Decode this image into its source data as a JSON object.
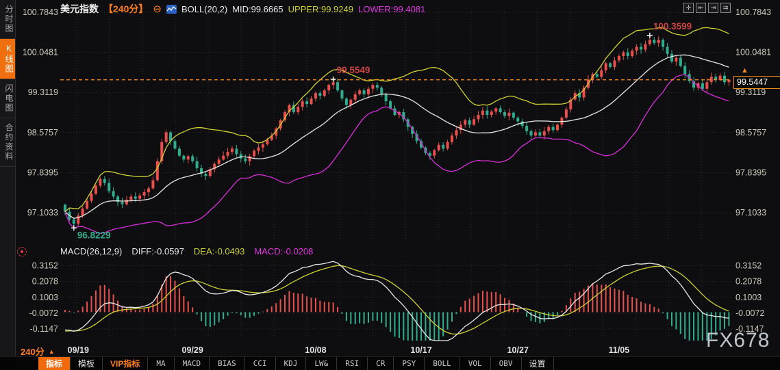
{
  "sidebar": {
    "items": [
      {
        "label": "分时图",
        "active": false
      },
      {
        "label": "K线图",
        "active": true
      },
      {
        "label": "闪电图",
        "active": false
      },
      {
        "label": "合约资料",
        "active": false
      }
    ]
  },
  "header": {
    "title": "美元指数",
    "period": "【240分】",
    "minus_glyph": "⊖",
    "indicator": "BOLL(20,2)",
    "mid": "MID:99.6665",
    "upper": "UPPER:99.9249",
    "lower": "LOWER:99.4081"
  },
  "window_controls": [
    {
      "name": "crosshair-icon",
      "glyph": "✛"
    },
    {
      "name": "scale-left-icon",
      "glyph": "⇤"
    },
    {
      "name": "scale-right-icon",
      "glyph": "⇥"
    },
    {
      "name": "pan-right-icon",
      "glyph": "⇉"
    }
  ],
  "macd_header": {
    "name": "MACD(26,12,9)",
    "diff": "DIFF:-0.0597",
    "dea": "DEA:-0.0493",
    "macd": "MACD:-0.0208"
  },
  "price_box": {
    "value": "99.5447"
  },
  "bottom_left": {
    "period": "240分",
    "arrow": "▲"
  },
  "watermark": "FX678",
  "toolbar": {
    "items": [
      {
        "label": "指标",
        "variant": "active"
      },
      {
        "label": "模板",
        "variant": "normal"
      },
      {
        "label": "VIP指标",
        "variant": "accent"
      },
      {
        "label": "MA",
        "variant": "mono"
      },
      {
        "label": "MACD",
        "variant": "mono"
      },
      {
        "label": "BIAS",
        "variant": "mono"
      },
      {
        "label": "CCI",
        "variant": "mono"
      },
      {
        "label": "KDJ",
        "variant": "mono"
      },
      {
        "label": "LW&",
        "variant": "mono"
      },
      {
        "label": "RSI",
        "variant": "mono"
      },
      {
        "label": "CR",
        "variant": "mono"
      },
      {
        "label": "PSY",
        "variant": "mono"
      },
      {
        "label": "BOLL",
        "variant": "mono"
      },
      {
        "label": "VOL",
        "variant": "mono"
      },
      {
        "label": "OBV",
        "variant": "mono"
      },
      {
        "label": "设置",
        "variant": "normal"
      }
    ]
  },
  "chart_data": {
    "type": "candlestick+macd",
    "symbol": "美元指数",
    "interval": "240分",
    "boll": {
      "params": "(20,2)",
      "mid": 99.6665,
      "upper": 99.9249,
      "lower": 99.4081
    },
    "macd": {
      "params": "(26,12,9)",
      "diff": -0.0597,
      "dea": -0.0493,
      "macd": -0.0208
    },
    "last_price": 99.5447,
    "y_axis_labels": [
      100.7843,
      100.0481,
      99.3119,
      98.5757,
      97.8395,
      97.1033
    ],
    "macd_axis_labels": [
      0.3152,
      0.2078,
      0.1003,
      -0.0072,
      -0.1147
    ],
    "x_labels": [
      {
        "label": "09/19",
        "index": 3
      },
      {
        "label": "09/29",
        "index": 29
      },
      {
        "label": "10/08",
        "index": 57
      },
      {
        "label": "10/17",
        "index": 81
      },
      {
        "label": "10/27",
        "index": 103
      },
      {
        "label": "11/05",
        "index": 126
      }
    ],
    "first_open": 97.25,
    "closes": [
      97.12,
      96.98,
      96.9,
      97.05,
      97.18,
      97.32,
      97.45,
      97.6,
      97.72,
      97.65,
      97.5,
      97.4,
      97.3,
      97.26,
      97.34,
      97.4,
      97.36,
      97.42,
      97.48,
      97.55,
      97.7,
      98.05,
      98.4,
      98.58,
      98.42,
      98.28,
      98.15,
      98.08,
      98.14,
      98.05,
      97.92,
      97.82,
      97.78,
      97.9,
      98.0,
      98.08,
      98.15,
      98.22,
      98.28,
      98.18,
      98.1,
      98.05,
      98.14,
      98.24,
      98.3,
      98.36,
      98.44,
      98.52,
      98.65,
      98.8,
      98.95,
      99.08,
      98.95,
      99.05,
      99.15,
      99.1,
      99.2,
      99.3,
      99.25,
      99.35,
      99.45,
      99.5,
      99.35,
      99.2,
      99.08,
      99.18,
      99.28,
      99.35,
      99.28,
      99.38,
      99.45,
      99.4,
      99.28,
      99.15,
      99.02,
      98.9,
      98.95,
      98.82,
      98.68,
      98.55,
      98.42,
      98.3,
      98.2,
      98.15,
      98.25,
      98.35,
      98.28,
      98.4,
      98.52,
      98.62,
      98.72,
      98.8,
      98.72,
      98.82,
      98.9,
      98.98,
      98.9,
      98.96,
      99.02,
      98.95,
      98.88,
      98.94,
      98.85,
      98.78,
      98.7,
      98.6,
      98.52,
      98.58,
      98.52,
      98.6,
      98.68,
      98.62,
      98.72,
      98.85,
      99.0,
      99.18,
      99.3,
      99.22,
      99.4,
      99.55,
      99.65,
      99.6,
      99.72,
      99.85,
      99.78,
      99.9,
      99.98,
      100.05,
      99.98,
      100.08,
      100.15,
      100.1,
      100.2,
      100.28,
      100.22,
      100.28,
      100.15,
      100.02,
      99.88,
      99.95,
      99.8,
      99.65,
      99.52,
      99.4,
      99.48,
      99.38,
      99.5,
      99.6,
      99.54,
      99.62,
      99.5,
      99.5447
    ],
    "wick_overrides": {
      "2": {
        "low": 96.8229
      },
      "61": {
        "high": 99.5549
      },
      "133": {
        "high": 100.3599
      }
    },
    "markers": [
      {
        "index": 2,
        "price": 96.8229,
        "label": "96.8229",
        "color": "#2fae8f",
        "placement": "below"
      },
      {
        "index": 61,
        "price": 99.5549,
        "label": "99.5549",
        "color": "#cd4440",
        "placement": "above"
      },
      {
        "index": 133,
        "price": 100.3599,
        "label": "100.3599",
        "color": "#cd4440",
        "placement": "above"
      }
    ],
    "colors": {
      "up": "#e9504d",
      "down": "#2fae8f",
      "boll_upper": "#cfd232",
      "boll_mid": "#e8e8e8",
      "boll_lower": "#d92fd9",
      "dif_line": "#e8e8e8",
      "dea_line": "#cfd232",
      "accent": "#ff7e1e",
      "dashed_line": "#f28a1e",
      "grid": "#303338",
      "axis_text": "#cfcbbd",
      "date_text": "#e2e2e2"
    }
  }
}
